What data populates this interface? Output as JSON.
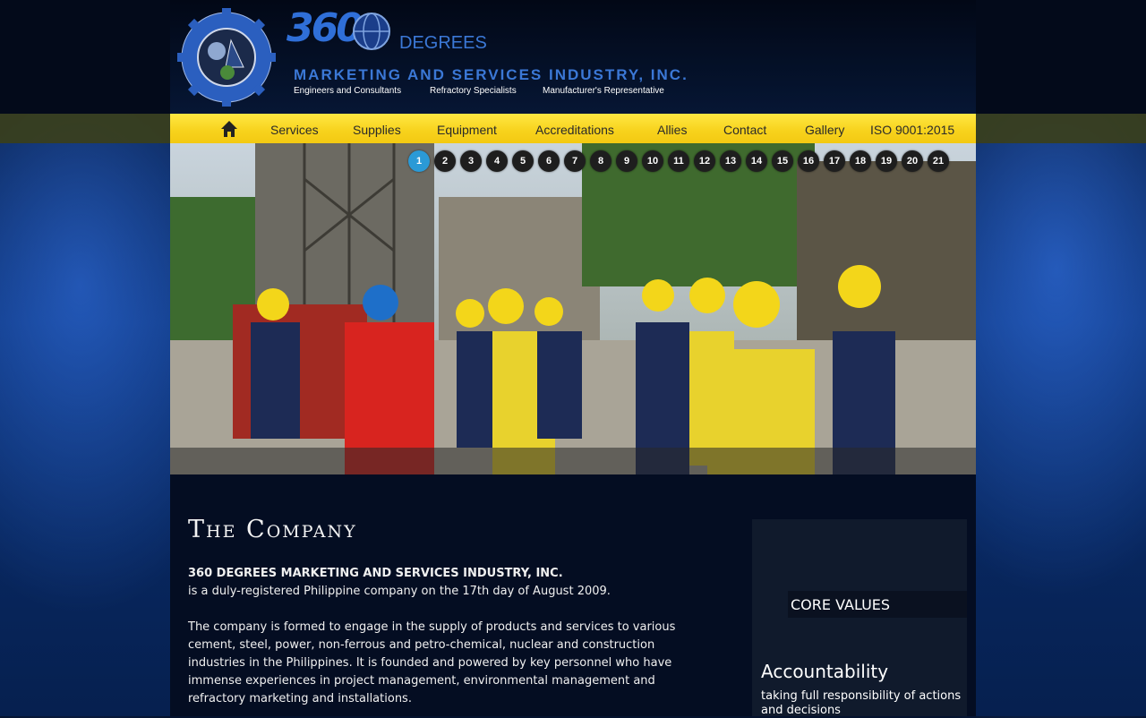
{
  "header": {
    "logo_number": "360",
    "logo_word": "DEGREES",
    "company_name": "MARKETING AND SERVICES INDUSTRY, INC.",
    "seal_text": "360 DEGREES MARKETING & SERVICES INDUSTRY, INC",
    "taglines": [
      "Engineers and Consultants",
      "Refractory Specialists",
      "Manufacturer's Representative"
    ]
  },
  "nav": {
    "home_icon": "home-icon",
    "items": [
      "Services",
      "Supplies",
      "Equipment",
      "Accreditations",
      "Allies",
      "Contact",
      "Gallery",
      "ISO 9001:2015"
    ]
  },
  "slider": {
    "pages": [
      "1",
      "2",
      "3",
      "4",
      "5",
      "6",
      "7",
      "8",
      "9",
      "10",
      "11",
      "12",
      "13",
      "14",
      "15",
      "16",
      "17",
      "18",
      "19",
      "20",
      "21"
    ],
    "active_page": "1"
  },
  "content": {
    "title": "The Company",
    "company_line": "360 DEGREES MARKETING AND SERVICES INDUSTRY, INC.",
    "registration": "is a duly-registered Philippine company on the 17th day of August 2009.",
    "description": "The company is formed to engage in the supply of products and services to various cement, steel, power, non-ferrous and petro-chemical, nuclear and construction industries in the Philippines. It is founded and powered by key personnel who have immense experiences in project management, environmental management and refractory marketing and installations."
  },
  "sidebar": {
    "heading": "CORE VALUES",
    "value_title": "Accountability",
    "value_text": "taking full responsibility of actions and decisions"
  },
  "colors": {
    "nav_yellow": "#f7d21c",
    "brand_blue": "#3b78d6",
    "active_dot": "#2b9ad6"
  }
}
